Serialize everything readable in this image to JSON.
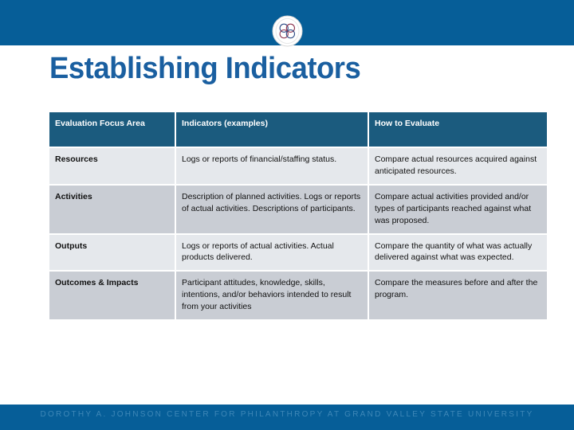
{
  "slide": {
    "title": "Establishing Indicators",
    "logo_icon": "interlocking-circles-emblem",
    "accent_band_color": "#065E98",
    "title_color": "#1A5FA0"
  },
  "table": {
    "header_bg": "#1B5B7E",
    "row_light_bg": "#e5e8ec",
    "row_dark_bg": "#c9cdd4",
    "columns": [
      "Evaluation Focus Area",
      "Indicators (examples)",
      "How to Evaluate"
    ],
    "rows": [
      {
        "focus_area": "Resources",
        "indicators": "Logs or reports of financial/staffing status.",
        "how_to_evaluate": "Compare actual resources acquired against anticipated resources."
      },
      {
        "focus_area": "Activities",
        "indicators": "Description of planned activities. Logs or reports of actual activities. Descriptions of participants.",
        "how_to_evaluate": "Compare actual activities provided and/or types of participants reached against what was proposed."
      },
      {
        "focus_area": "Outputs",
        "indicators": "Logs or reports of actual activities. Actual products delivered.",
        "how_to_evaluate": "Compare the quantity of what was actually delivered against what was expected."
      },
      {
        "focus_area": "Outcomes & Impacts",
        "indicators": "Participant attitudes, knowledge, skills, intentions, and/or behaviors intended to result from your activities",
        "how_to_evaluate": "Compare the measures before and after the program."
      }
    ]
  },
  "footer": {
    "text": "DOROTHY A. JOHNSON CENTER FOR PHILANTHROPY AT GRAND VALLEY STATE UNIVERSITY",
    "text_color": "#3e87b7"
  }
}
